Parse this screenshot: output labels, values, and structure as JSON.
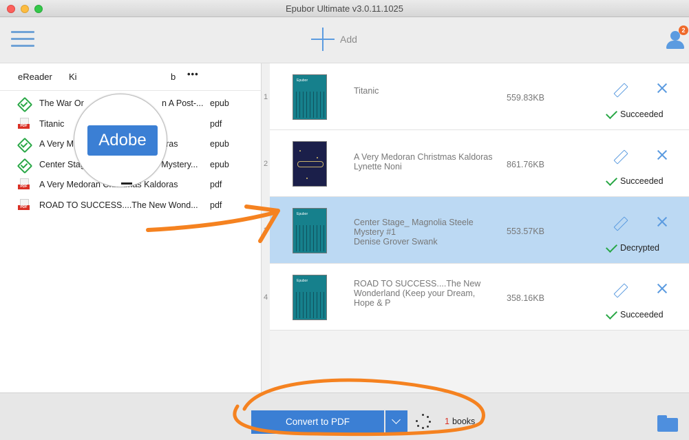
{
  "window": {
    "title": "Epubor Ultimate v3.0.11.1025"
  },
  "toolbar": {
    "menu_icon": "hamburger-menu-icon",
    "add_label": "Add",
    "add_icon": "plus-icon",
    "account_icon": "user-icon",
    "notification_count": "2"
  },
  "source_tabs": {
    "items": [
      {
        "label": "eReader"
      },
      {
        "label": "Ki"
      },
      {
        "label": "b"
      },
      {
        "label": "•••"
      }
    ],
    "magnified_tab": "Adobe"
  },
  "library": {
    "items": [
      {
        "title": "The War Or",
        "title_tail": "n A Post-...",
        "format": "epub",
        "icon": "epub-icon"
      },
      {
        "title": "Titanic",
        "format": "pdf",
        "icon": "pdf-icon"
      },
      {
        "title": "A Very Medoran Christmas Kaldoras",
        "format": "epub",
        "icon": "epub-icon"
      },
      {
        "title": "Center Stage_ Magnolia Steele Mystery...",
        "format": "epub",
        "icon": "epub-icon"
      },
      {
        "title": "A Very Medoran Christmas Kaldoras",
        "format": "pdf",
        "icon": "pdf-icon"
      },
      {
        "title": "ROAD TO SUCCESS....The New Wond...",
        "format": "pdf",
        "icon": "pdf-icon"
      }
    ],
    "pdf_tag": "PDF"
  },
  "conversion_list": {
    "items": [
      {
        "index": "1",
        "title": "Titanic",
        "author": "",
        "size": "559.83KB",
        "status": "Succeeded",
        "cover_brand": "Epubor"
      },
      {
        "index": "2",
        "title": "A Very Medoran Christmas Kaldoras",
        "author": "Lynette Noni",
        "size": "861.76KB",
        "status": "Succeeded",
        "cover_brand": ""
      },
      {
        "index": "3",
        "title": "Center Stage_ Magnolia Steele Mystery #1",
        "author": "Denise Grover Swank",
        "size": "553.57KB",
        "status": "Decrypted",
        "cover_brand": "Epubor"
      },
      {
        "index": "4",
        "title": "ROAD TO SUCCESS....The New Wonderland (Keep your Dream, Hope & P",
        "author": "",
        "size": "358.16KB",
        "status": "Succeeded",
        "cover_brand": "Epubor"
      }
    ]
  },
  "bottom_bar": {
    "convert_label": "Convert to PDF",
    "books_count": "1",
    "books_label": "books",
    "folder_icon": "folder-icon"
  },
  "colors": {
    "accent": "#3b7fd4",
    "selected_row": "#bcd9f3",
    "success": "#28a745",
    "badge": "#ef6a2b",
    "annotation": "#f58220"
  }
}
